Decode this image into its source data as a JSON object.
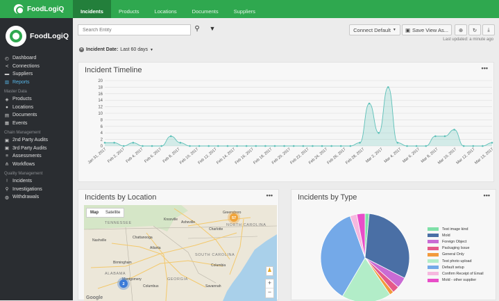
{
  "brand": {
    "name": "FoodLogiQ"
  },
  "topnav": {
    "tabs": [
      "Incidents",
      "Products",
      "Locations",
      "Documents",
      "Suppliers"
    ],
    "active": "Incidents"
  },
  "sidebar": {
    "brand": "FoodLogiQ",
    "main_items": [
      {
        "label": "Dashboard",
        "icon": "dashboard-icon"
      },
      {
        "label": "Connections",
        "icon": "share-icon"
      },
      {
        "label": "Suppliers",
        "icon": "truck-icon"
      },
      {
        "label": "Reports",
        "icon": "bar-chart-icon",
        "active": true
      }
    ],
    "sections": [
      {
        "title": "Master Data",
        "items": [
          {
            "label": "Products",
            "icon": "cube-icon"
          },
          {
            "label": "Locations",
            "icon": "map-marker-icon"
          },
          {
            "label": "Documents",
            "icon": "document-icon"
          },
          {
            "label": "Events",
            "icon": "calendar-icon"
          }
        ]
      },
      {
        "title": "Chain Management",
        "items": [
          {
            "label": "2nd Party Audits",
            "icon": "clipboard-icon"
          },
          {
            "label": "3rd Party Audits",
            "icon": "clipboard-icon"
          },
          {
            "label": "Assessments",
            "icon": "checklist-icon"
          },
          {
            "label": "Workflows",
            "icon": "sitemap-icon"
          }
        ]
      },
      {
        "title": "Quality Management",
        "items": [
          {
            "label": "Incidents",
            "icon": "exclamation-icon"
          },
          {
            "label": "Investigations",
            "icon": "search-icon"
          },
          {
            "label": "Withdrawals",
            "icon": "globe-icon"
          }
        ]
      }
    ]
  },
  "toolbar": {
    "search_placeholder": "Search Entity",
    "connect_label": "Connect Default",
    "save_view_label": "Save View As...",
    "last_updated": "Last updated: a minute ago"
  },
  "filter": {
    "name": "Incident Date:",
    "value": "Last 60 days"
  },
  "cards": {
    "timeline_title": "Incident Timeline",
    "location_title": "Incidents by Location",
    "type_title": "Incidents by Type",
    "menu": "•••"
  },
  "map": {
    "toggle": [
      "Map",
      "Satellite"
    ],
    "labels": [
      "TENNESSEE",
      "Greensboro",
      "Asheville",
      "Charlotte",
      "NORTH CAROLINA",
      "SOUTH CAROLINA",
      "GEORGIA",
      "Atlanta",
      "Birmingham",
      "ALABAMA",
      "Montgomery",
      "Columbus",
      "Savannah",
      "Nashville",
      "Knoxville",
      "Chattanooga",
      "Columbia"
    ],
    "clusters": [
      {
        "label": "57",
        "color": "#f0a43a"
      },
      {
        "label": "2",
        "color": "#3b7bd8"
      }
    ],
    "google": "Google",
    "zoom_in": "+",
    "zoom_out": "−"
  },
  "chart_data": [
    {
      "type": "area",
      "title": "Incident Timeline",
      "ylim": [
        0,
        20
      ],
      "yticks": [
        0,
        2,
        4,
        6,
        8,
        10,
        12,
        14,
        16,
        18,
        20
      ],
      "x_tick_labels": [
        "Jan 31, 2017",
        "Feb 2, 2017",
        "Feb 4, 2017",
        "Feb 6, 2017",
        "Feb 8, 2017",
        "Feb 10, 2017",
        "Feb 12, 2017",
        "Feb 14, 2017",
        "Feb 16, 2017",
        "Feb 18, 2017",
        "Feb 20, 2017",
        "Feb 22, 2017",
        "Feb 24, 2017",
        "Feb 26, 2017",
        "Feb 28, 2017",
        "Mar 2, 2017",
        "Mar 4, 2017",
        "Mar 6, 2017",
        "Mar 8, 2017",
        "Mar 10, 2017",
        "Mar 12, 2017",
        "Mar 13, 2017"
      ],
      "x": [
        "Jan 31, 2017",
        "Feb 1, 2017",
        "Feb 2, 2017",
        "Feb 3, 2017",
        "Feb 4, 2017",
        "Feb 5, 2017",
        "Feb 6, 2017",
        "Feb 7, 2017",
        "Feb 8, 2017",
        "Feb 9, 2017",
        "Feb 10, 2017",
        "Feb 11, 2017",
        "Feb 12, 2017",
        "Feb 13, 2017",
        "Feb 14, 2017",
        "Feb 15, 2017",
        "Feb 16, 2017",
        "Feb 17, 2017",
        "Feb 18, 2017",
        "Feb 19, 2017",
        "Feb 20, 2017",
        "Feb 21, 2017",
        "Feb 22, 2017",
        "Feb 23, 2017",
        "Feb 24, 2017",
        "Feb 25, 2017",
        "Feb 26, 2017",
        "Feb 27, 2017",
        "Feb 28, 2017",
        "Mar 1, 2017",
        "Mar 2, 2017",
        "Mar 3, 2017",
        "Mar 4, 2017",
        "Mar 5, 2017",
        "Mar 6, 2017",
        "Mar 7, 2017",
        "Mar 8, 2017",
        "Mar 9, 2017",
        "Mar 10, 2017",
        "Mar 11, 2017",
        "Mar 12, 2017",
        "Mar 13, 2017"
      ],
      "series": [
        {
          "values": [
            1,
            1,
            0,
            1,
            0,
            0,
            0,
            3,
            1,
            0,
            0,
            0,
            0,
            0,
            0,
            0,
            0,
            0,
            0,
            0,
            0,
            0,
            0,
            0,
            0,
            0,
            0,
            1,
            13,
            4,
            18,
            1,
            0,
            0,
            0,
            3,
            3,
            5,
            0,
            0,
            0,
            1
          ],
          "color": "#8fd3cc"
        }
      ],
      "grid": true
    },
    {
      "type": "pie",
      "title": "Incidents by Type",
      "legend_position": "right",
      "slices": [
        {
          "label": "Test image kind",
          "value": 1.5,
          "color": "#7fe0a8"
        },
        {
          "label": "Mold",
          "value": 31,
          "color": "#4a6fa5"
        },
        {
          "label": "Foreign Object",
          "value": 4,
          "color": "#c96bd4"
        },
        {
          "label": "Packaging Issue",
          "value": 2.5,
          "color": "#e55a8a"
        },
        {
          "label": "General Only",
          "value": 1.5,
          "color": "#f29a3c"
        },
        {
          "label": "Test photo upload",
          "value": 18,
          "color": "#b2edc8"
        },
        {
          "label": "Default setup",
          "value": 36,
          "color": "#74a9e8"
        },
        {
          "label": "Confirm Receipt of Email",
          "value": 2.5,
          "color": "#f6b8df"
        },
        {
          "label": "Mold - other supplier",
          "value": 3,
          "color": "#e84ec8"
        }
      ]
    }
  ]
}
